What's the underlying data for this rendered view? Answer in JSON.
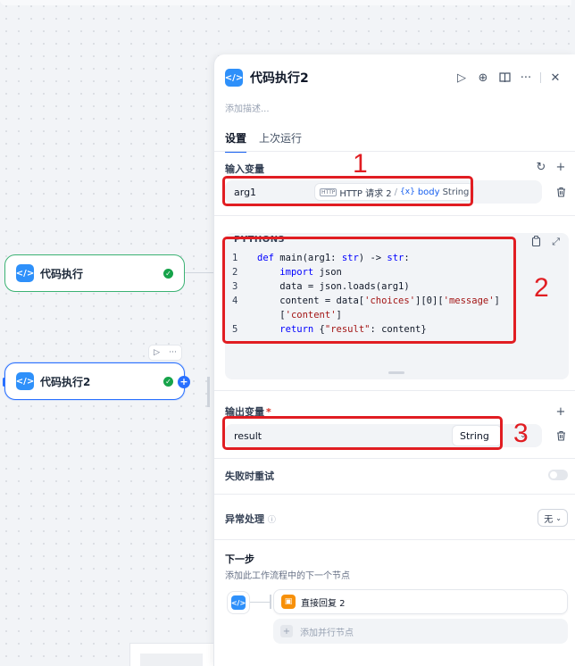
{
  "canvas": {
    "nodes": [
      {
        "title": "代码执行",
        "icon": "code-icon"
      },
      {
        "title": "代码执行2",
        "icon": "code-icon"
      }
    ],
    "toolbar": {
      "run_icon": "▷",
      "more_icon": "···"
    }
  },
  "panel": {
    "title": "代码执行2",
    "description_placeholder": "添加描述...",
    "header_icons": [
      "play-icon",
      "locate-icon",
      "book-icon",
      "more-icon",
      "close-icon"
    ],
    "tabs": [
      "设置",
      "上次运行"
    ],
    "input_section": {
      "label": "输入变量",
      "variables": [
        {
          "name": "arg1",
          "ref_node_badge": "HTTP",
          "ref_node": "HTTP 请求 2",
          "ref_sep": "/",
          "ref_var_icon": "{x}",
          "ref_var": "body",
          "ref_type": "String"
        }
      ]
    },
    "code": {
      "language": "PYTHON3",
      "lines": [
        {
          "n": "1",
          "html": "<span class='kw'>def</span> main(arg1: <span class='kw'>str</span>) -> <span class='kw'>str</span>:"
        },
        {
          "n": "2",
          "html": "    <span class='kw'>import</span> json"
        },
        {
          "n": "3",
          "html": "    data = json.loads(arg1)"
        },
        {
          "n": "4",
          "html": "    content = data[<span class='str'>'choices'</span>][0][<span class='str'>'message'</span>]\n    [<span class='str'>'content'</span>]"
        },
        {
          "n": "5",
          "html": "    <span class='kw'>return</span> {<span class='str'>\"result\"</span>: content}"
        }
      ]
    },
    "output_section": {
      "label": "输出变量",
      "required_mark": "*",
      "variables": [
        {
          "name": "result",
          "type": "String"
        }
      ]
    },
    "retry": {
      "label": "失败时重试"
    },
    "error_handling": {
      "label": "异常处理",
      "value": "无"
    },
    "next_step": {
      "title": "下一步",
      "description": "添加此工作流程中的下一个节点",
      "target": "直接回复 2",
      "add_parallel": "添加并行节点"
    }
  },
  "annotations": [
    "1",
    "2",
    "3"
  ],
  "colors": {
    "accent": "#155eef",
    "annotation": "#e11d22",
    "success": "#16a34a",
    "code_icon": "#2e90fa"
  }
}
